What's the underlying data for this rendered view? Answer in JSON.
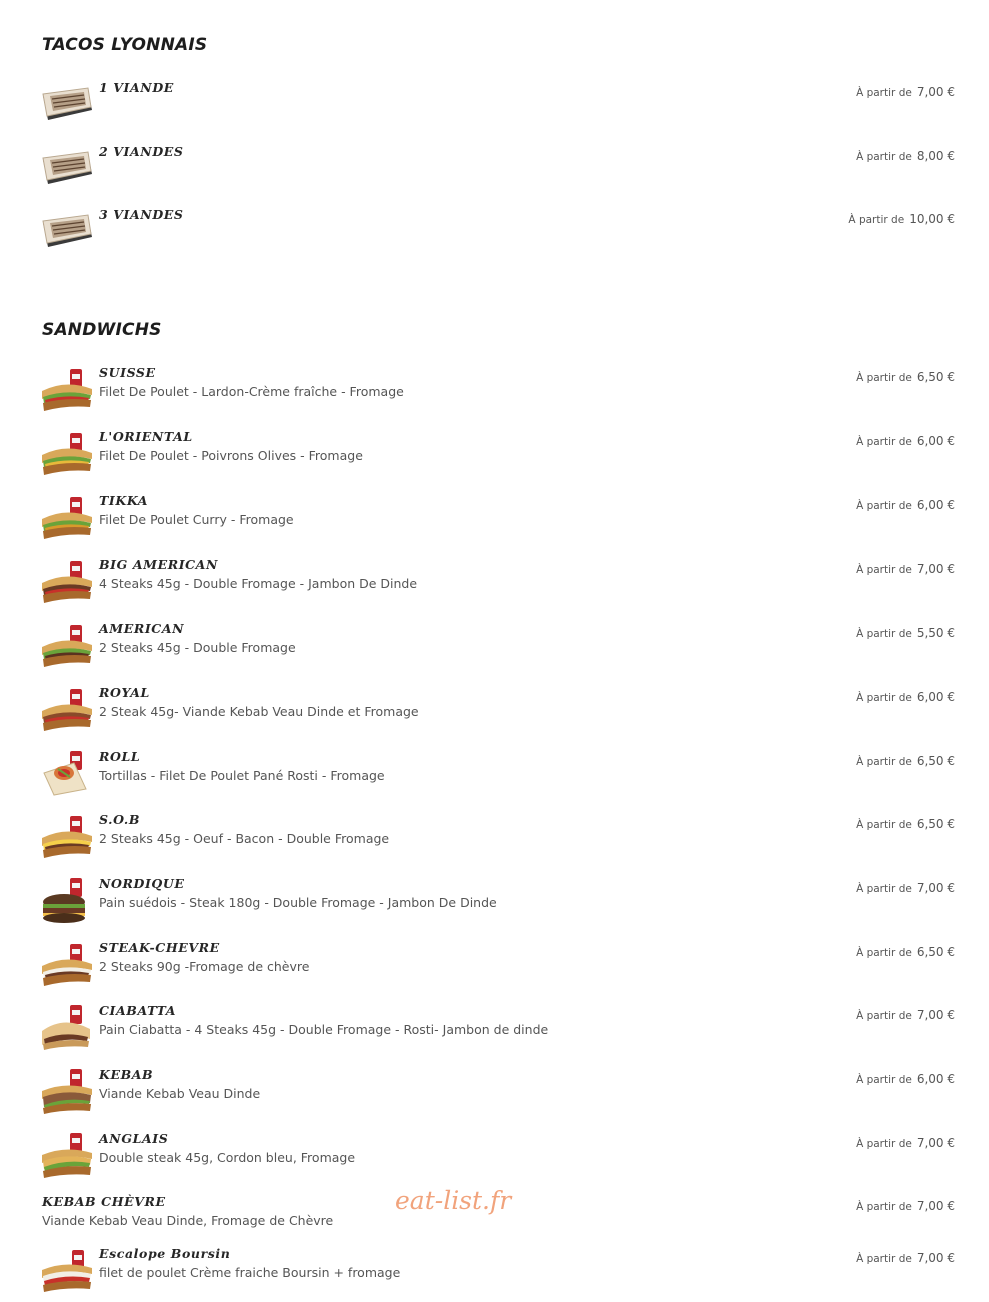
{
  "sections": [
    {
      "title": "TACOS LYONNAIS",
      "items": [
        {
          "name": "1 VIANDE",
          "desc": "",
          "from": "À partir de",
          "price": "7,00 €",
          "icon": "tacos-icon"
        },
        {
          "name": "2 VIANDES",
          "desc": "",
          "from": "À partir de",
          "price": "8,00 €",
          "icon": "tacos-icon"
        },
        {
          "name": "3 VIANDES",
          "desc": "",
          "from": "À partir de",
          "price": "10,00 €",
          "icon": "tacos-icon"
        }
      ]
    },
    {
      "title": "SANDWICHS",
      "items": [
        {
          "name": "SUISSE",
          "desc": "Filet De Poulet - Lardon-Crème fraîche - Fromage",
          "from": "À partir de",
          "price": "6,50 €",
          "icon": "sandwich-icon"
        },
        {
          "name": "L'ORIENTAL",
          "desc": "Filet De Poulet - Poivrons Olives - Fromage",
          "from": "À partir de",
          "price": "6,00 €",
          "icon": "sandwich-icon"
        },
        {
          "name": "TIKKA",
          "desc": "Filet De Poulet Curry - Fromage",
          "from": "À partir de",
          "price": "6,00 €",
          "icon": "sandwich-icon"
        },
        {
          "name": "BIG AMERICAN",
          "desc": "4 Steaks 45g - Double Fromage - Jambon De Dinde",
          "from": "À partir de",
          "price": "7,00 €",
          "icon": "sandwich-icon"
        },
        {
          "name": "AMERICAN",
          "desc": "2 Steaks 45g - Double Fromage",
          "from": "À partir de",
          "price": "5,50 €",
          "icon": "sandwich-icon"
        },
        {
          "name": "ROYAL",
          "desc": "2 Steak 45g- Viande Kebab Veau Dinde et Fromage",
          "from": "À partir de",
          "price": "6,00 €",
          "icon": "sandwich-icon"
        },
        {
          "name": "ROLL",
          "desc": "Tortillas - Filet De Poulet Pané Rosti - Fromage",
          "from": "À partir de",
          "price": "6,50 €",
          "icon": "wrap-icon"
        },
        {
          "name": "S.O.B",
          "desc": "2 Steaks 45g - Oeuf - Bacon - Double Fromage",
          "from": "À partir de",
          "price": "6,50 €",
          "icon": "sandwich-icon"
        },
        {
          "name": "NORDIQUE",
          "desc": "Pain suédois - Steak 180g - Double Fromage - Jambon De Dinde",
          "from": "À partir de",
          "price": "7,00 €",
          "icon": "burger-icon"
        },
        {
          "name": "STEAK-CHEVRE",
          "desc": "2 Steaks 90g -Fromage de chèvre",
          "from": "À partir de",
          "price": "6,50 €",
          "icon": "sandwich-icon"
        },
        {
          "name": "CIABATTA",
          "desc": "Pain Ciabatta - 4 Steaks 45g - Double Fromage - Rosti- Jambon de dinde",
          "from": "À partir de",
          "price": "7,00 €",
          "icon": "sandwich-icon"
        },
        {
          "name": "KEBAB",
          "desc": "Viande Kebab Veau Dinde",
          "from": "À partir de",
          "price": "6,00 €",
          "icon": "sandwich-icon"
        },
        {
          "name": "ANGLAIS",
          "desc": "Double steak 45g, Cordon bleu, Fromage",
          "from": "À partir de",
          "price": "7,00 €",
          "icon": "sandwich-icon"
        },
        {
          "name": "KEBAB CHÈVRE",
          "desc": "Viande Kebab Veau Dinde, Fromage de Chèvre",
          "from": "À partir de",
          "price": "7,00 €",
          "icon": ""
        },
        {
          "name": "Escalope Boursin",
          "desc": "filet de poulet Crème fraiche Boursin + fromage",
          "from": "À partir de",
          "price": "7,00 €",
          "icon": "sandwich-icon"
        }
      ]
    }
  ],
  "watermark": "eat-list.fr",
  "colors": {
    "bread": "#d9a85a",
    "crust": "#a8692c",
    "lettuce": "#6aa33a",
    "tomato": "#c8312a",
    "can": "#c0262d",
    "tacos_wrap": "#e9dfd0",
    "tacos_grill": "#8a6a4a",
    "watermark": "#f1a37c"
  }
}
